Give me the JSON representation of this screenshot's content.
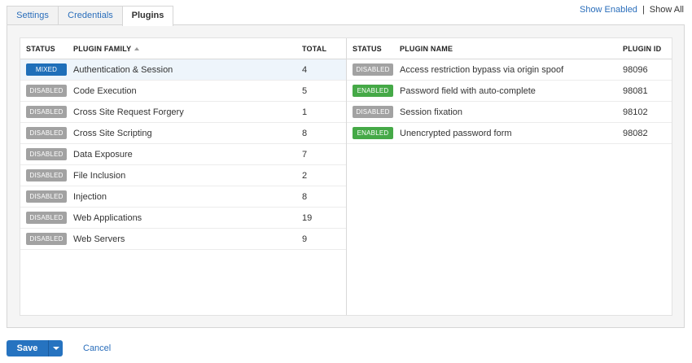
{
  "tabs": [
    {
      "label": "Settings",
      "active": false
    },
    {
      "label": "Credentials",
      "active": false
    },
    {
      "label": "Plugins",
      "active": true
    }
  ],
  "filter": {
    "show_enabled": "Show Enabled",
    "separator": "|",
    "show_all": "Show All"
  },
  "families": {
    "headers": {
      "status": "STATUS",
      "family": "PLUGIN FAMILY",
      "total": "TOTAL"
    },
    "sort_icon": "sort-ascending-icon",
    "rows": [
      {
        "status": "MIXED",
        "family": "Authentication & Session",
        "total": "4"
      },
      {
        "status": "DISABLED",
        "family": "Code Execution",
        "total": "5"
      },
      {
        "status": "DISABLED",
        "family": "Cross Site Request Forgery",
        "total": "1"
      },
      {
        "status": "DISABLED",
        "family": "Cross Site Scripting",
        "total": "8"
      },
      {
        "status": "DISABLED",
        "family": "Data Exposure",
        "total": "7"
      },
      {
        "status": "DISABLED",
        "family": "File Inclusion",
        "total": "2"
      },
      {
        "status": "DISABLED",
        "family": "Injection",
        "total": "8"
      },
      {
        "status": "DISABLED",
        "family": "Web Applications",
        "total": "19"
      },
      {
        "status": "DISABLED",
        "family": "Web Servers",
        "total": "9"
      }
    ]
  },
  "plugins": {
    "headers": {
      "status": "STATUS",
      "name": "PLUGIN NAME",
      "id": "PLUGIN ID"
    },
    "rows": [
      {
        "status": "DISABLED",
        "name": "Access restriction bypass via origin spoof",
        "id": "98096"
      },
      {
        "status": "ENABLED",
        "name": "Password field with auto-complete",
        "id": "98081"
      },
      {
        "status": "DISABLED",
        "name": "Session fixation",
        "id": "98102"
      },
      {
        "status": "ENABLED",
        "name": "Unencrypted password form",
        "id": "98082"
      }
    ]
  },
  "footer": {
    "save_label": "Save",
    "dropdown_icon": "caret-down-icon",
    "cancel_label": "Cancel"
  },
  "colors": {
    "accent": "#2a6ebb",
    "mixed": "#1f6fb9",
    "enabled": "#45a947",
    "disabled": "#a2a2a2"
  }
}
